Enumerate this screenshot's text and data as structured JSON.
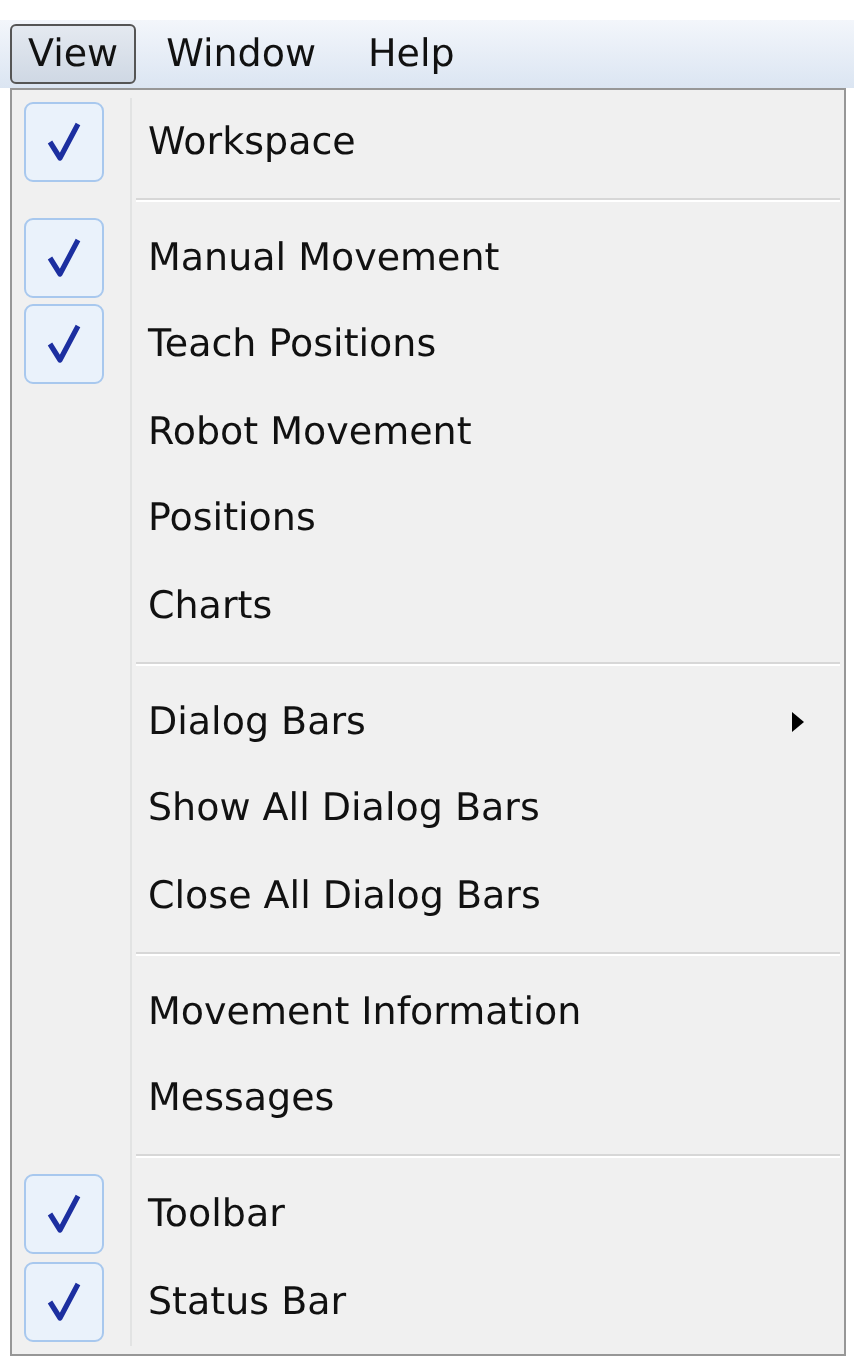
{
  "menu_bar": [
    {
      "label": "View",
      "selected": true
    },
    {
      "label": "Window",
      "selected": false
    },
    {
      "label": "Help",
      "selected": false
    }
  ],
  "menu": {
    "items": [
      {
        "kind": "item",
        "label": "Workspace",
        "checked": true
      },
      {
        "kind": "separator"
      },
      {
        "kind": "item",
        "label": "Manual Movement",
        "checked": true
      },
      {
        "kind": "item",
        "label": "Teach Positions",
        "checked": true
      },
      {
        "kind": "item",
        "label": "Robot Movement",
        "checked": false
      },
      {
        "kind": "item",
        "label": "Positions",
        "checked": false
      },
      {
        "kind": "item",
        "label": "Charts",
        "checked": false
      },
      {
        "kind": "separator"
      },
      {
        "kind": "submenu",
        "label": "Dialog Bars",
        "checked": false
      },
      {
        "kind": "item",
        "label": "Show All Dialog Bars",
        "checked": false
      },
      {
        "kind": "item",
        "label": "Close All Dialog Bars",
        "checked": false
      },
      {
        "kind": "separator"
      },
      {
        "kind": "item",
        "label": "Movement Information",
        "checked": false
      },
      {
        "kind": "item",
        "label": "Messages",
        "checked": false
      },
      {
        "kind": "separator"
      },
      {
        "kind": "item",
        "label": "Toolbar",
        "checked": true
      },
      {
        "kind": "item",
        "label": "Status Bar",
        "checked": true
      }
    ]
  }
}
